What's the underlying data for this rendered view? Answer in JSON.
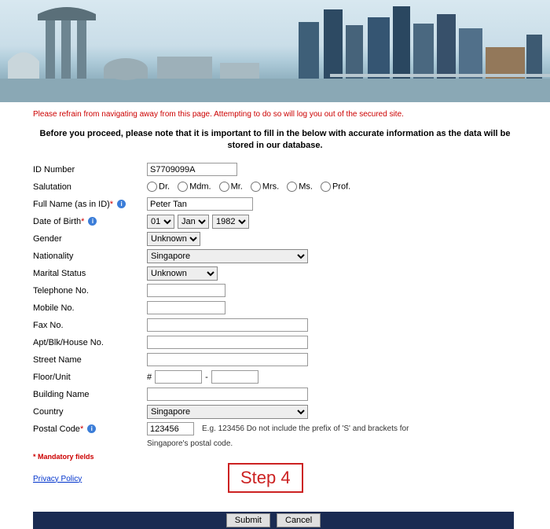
{
  "banner": {
    "alt": "Singapore skyline"
  },
  "warning": "Please refrain from navigating away from this page. Attempting to do so will log you out of the secured site.",
  "instruction": "Before you proceed, please note that it is important to fill in the below with accurate information as the data will be stored in our database.",
  "labels": {
    "id_number": "ID Number",
    "salutation": "Salutation",
    "full_name": "Full Name (as in ID)",
    "dob": "Date of Birth",
    "gender": "Gender",
    "nationality": "Nationality",
    "marital_status": "Marital Status",
    "telephone": "Telephone No.",
    "mobile": "Mobile No.",
    "fax": "Fax No.",
    "apt": "Apt/Blk/House No.",
    "street": "Street Name",
    "floor_unit": "Floor/Unit",
    "building": "Building Name",
    "country": "Country",
    "postal_code": "Postal Code"
  },
  "required_mark": "*",
  "values": {
    "id_number": "S7709099A",
    "full_name": "Peter Tan",
    "dob_day": "01",
    "dob_month": "Jan",
    "dob_year": "1982",
    "gender": "Unknown",
    "nationality": "Singapore",
    "marital_status": "Unknown",
    "telephone": "",
    "mobile": "",
    "fax": "",
    "apt": "",
    "street": "",
    "floor1": "",
    "floor2": "",
    "building": "",
    "country": "Singapore",
    "postal_code": "123456"
  },
  "salutations": {
    "dr": "Dr.",
    "mdm": "Mdm.",
    "mr": "Mr.",
    "mrs": "Mrs.",
    "ms": "Ms.",
    "prof": "Prof."
  },
  "floor_prefix": "#",
  "floor_sep": "-",
  "postal_hint": "E.g. 123456 Do not include the prefix of 'S' and brackets for",
  "postal_hint2": "Singapore's postal code.",
  "mandatory_note": "* Mandatory fields",
  "privacy_link": "Privacy Policy",
  "step_label": "Step 4",
  "buttons": {
    "submit": "Submit",
    "cancel": "Cancel"
  }
}
